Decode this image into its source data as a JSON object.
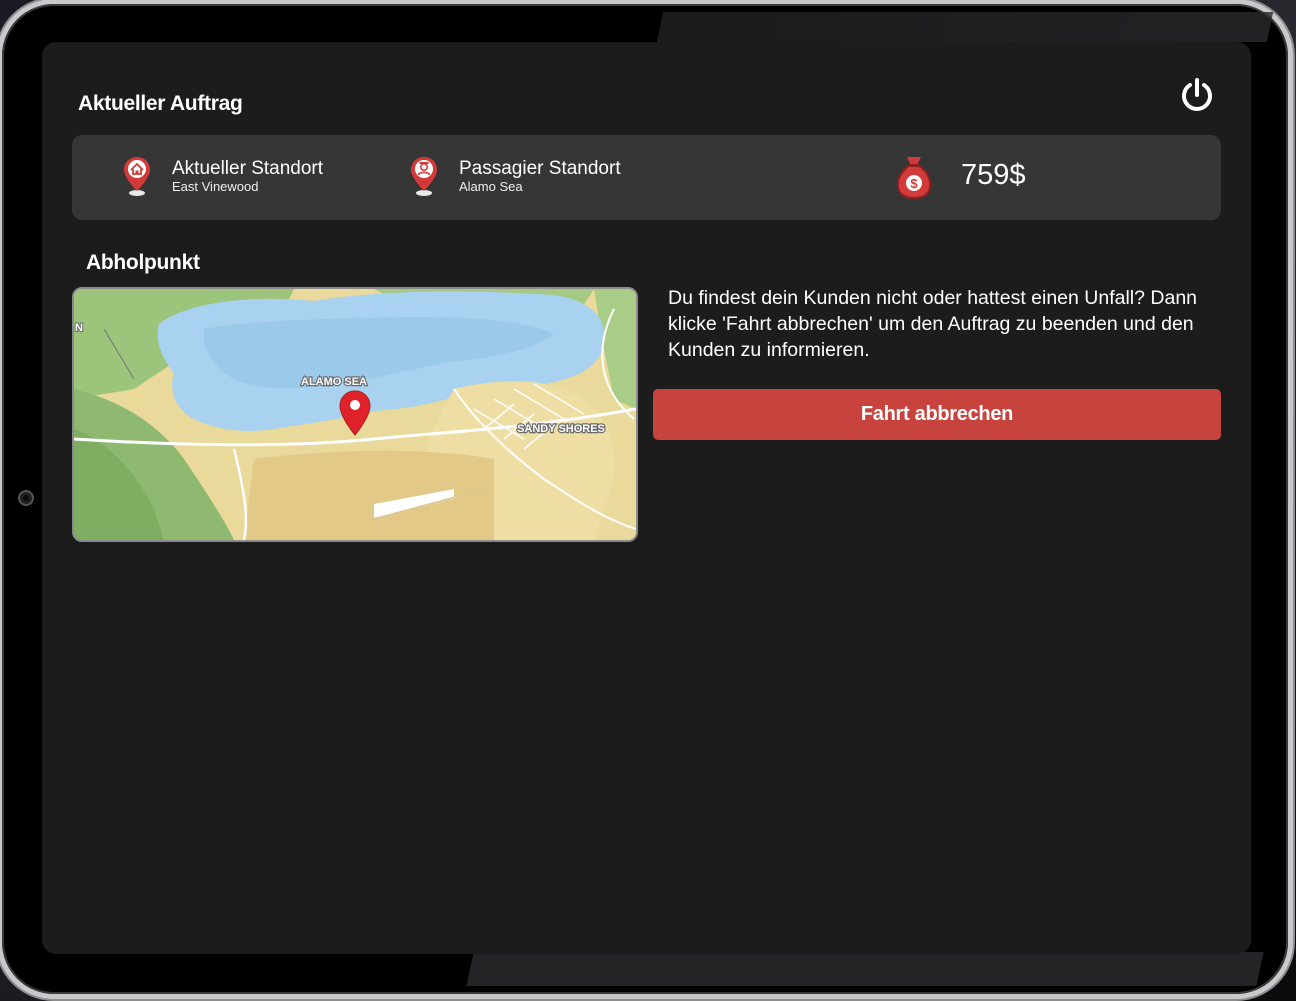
{
  "header": {
    "title": "Aktueller Auftrag",
    "power_icon": "power-icon"
  },
  "info_bar": {
    "current_location": {
      "label": "Aktueller Standort",
      "value": "East Vinewood",
      "icon": "home-pin-icon"
    },
    "passenger_location": {
      "label": "Passagier Standort",
      "value": "Alamo Sea",
      "icon": "person-pin-icon"
    },
    "fare": {
      "value": "759$",
      "icon": "money-bag-icon"
    }
  },
  "pickup": {
    "title": "Abholpunkt",
    "map": {
      "labels": [
        "ALAMO SEA",
        "SANDY SHORES",
        "N"
      ],
      "marker_icon": "map-pin-icon"
    }
  },
  "help_text": "Du findest dein Kunden nicht oder hattest einen Unfall? Dann klicke 'Fahrt abbrechen' um den Auftrag zu beenden und den Kunden zu informieren.",
  "cancel_button": {
    "label": "Fahrt abbrechen"
  },
  "colors": {
    "accent_red": "#c9433e",
    "panel": "#363636",
    "screen": "#1c1c1c"
  }
}
